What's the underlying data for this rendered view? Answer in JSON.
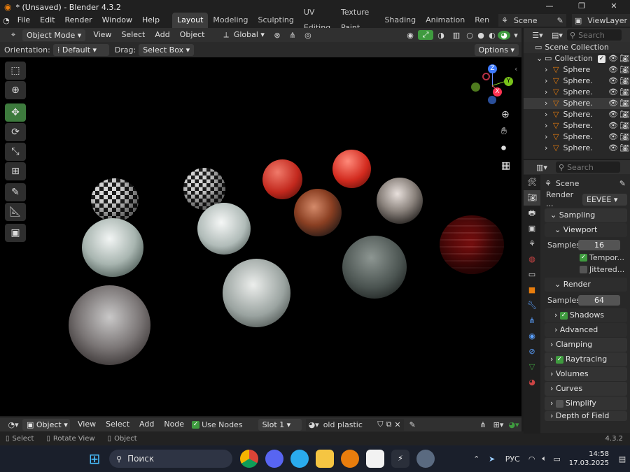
{
  "window": {
    "title": "* (Unsaved) - Blender 4.3.2",
    "min": "—",
    "max": "❐",
    "close": "✕"
  },
  "menu": [
    "File",
    "Edit",
    "Render",
    "Window",
    "Help"
  ],
  "workspaces": [
    "Layout",
    "Modeling",
    "Sculpting",
    "UV Editing",
    "Texture Paint",
    "Shading",
    "Animation",
    "Ren"
  ],
  "scene_selector": {
    "label": "Scene"
  },
  "view_layer": {
    "label": "ViewLayer"
  },
  "viewport_header": {
    "mode": "Object Mode",
    "menus": [
      "View",
      "Select",
      "Add",
      "Object"
    ],
    "transform": "Global"
  },
  "tool_settings": {
    "orientation_label": "Orientation:",
    "orientation": "Default",
    "drag_label": "Drag:",
    "drag": "Select Box",
    "options": "Options"
  },
  "outliner": {
    "search_placeholder": "Search",
    "root": "Scene Collection",
    "collection": "Collection",
    "items": [
      "Sphere",
      "Sphere.",
      "Sphere.",
      "Sphere.",
      "Sphere.",
      "Sphere.",
      "Sphere.",
      "Sphere."
    ]
  },
  "properties": {
    "search_placeholder": "Search",
    "scene": "Scene",
    "render_engine_label": "Render ...",
    "render_engine": "EEVEE",
    "sampling": "Sampling",
    "viewport": "Viewport",
    "viewport_samples_label": "Samples",
    "viewport_samples": "16",
    "temporal": "Tempor...",
    "jittered": "Jittered...",
    "render": "Render",
    "render_samples_label": "Samples",
    "render_samples": "64",
    "shadows": "Shadows",
    "advanced": "Advanced",
    "clamping": "Clamping",
    "raytracing": "Raytracing",
    "volumes": "Volumes",
    "curves": "Curves",
    "simplify": "Simplify",
    "depth_of_field": "Depth of Field"
  },
  "shader_header": {
    "object": "Object",
    "menus": [
      "View",
      "Select",
      "Add",
      "Node"
    ],
    "use_nodes": "Use Nodes",
    "slot": "Slot 1",
    "material": "old plastic"
  },
  "status_bar": {
    "select": "Select",
    "rotate": "Rotate View",
    "object": "Object",
    "version": "4.3.2"
  },
  "taskbar": {
    "search": "Поиск",
    "lang": "РУС",
    "time": "14:58",
    "date": "17.03.2025"
  },
  "gizmo": {
    "x": "X",
    "y": "Y",
    "z": "Z"
  },
  "colors": {
    "accent_green": "#3f9b3f",
    "blender_orange": "#e87d0d",
    "active_tool": "#3d7a3d"
  }
}
